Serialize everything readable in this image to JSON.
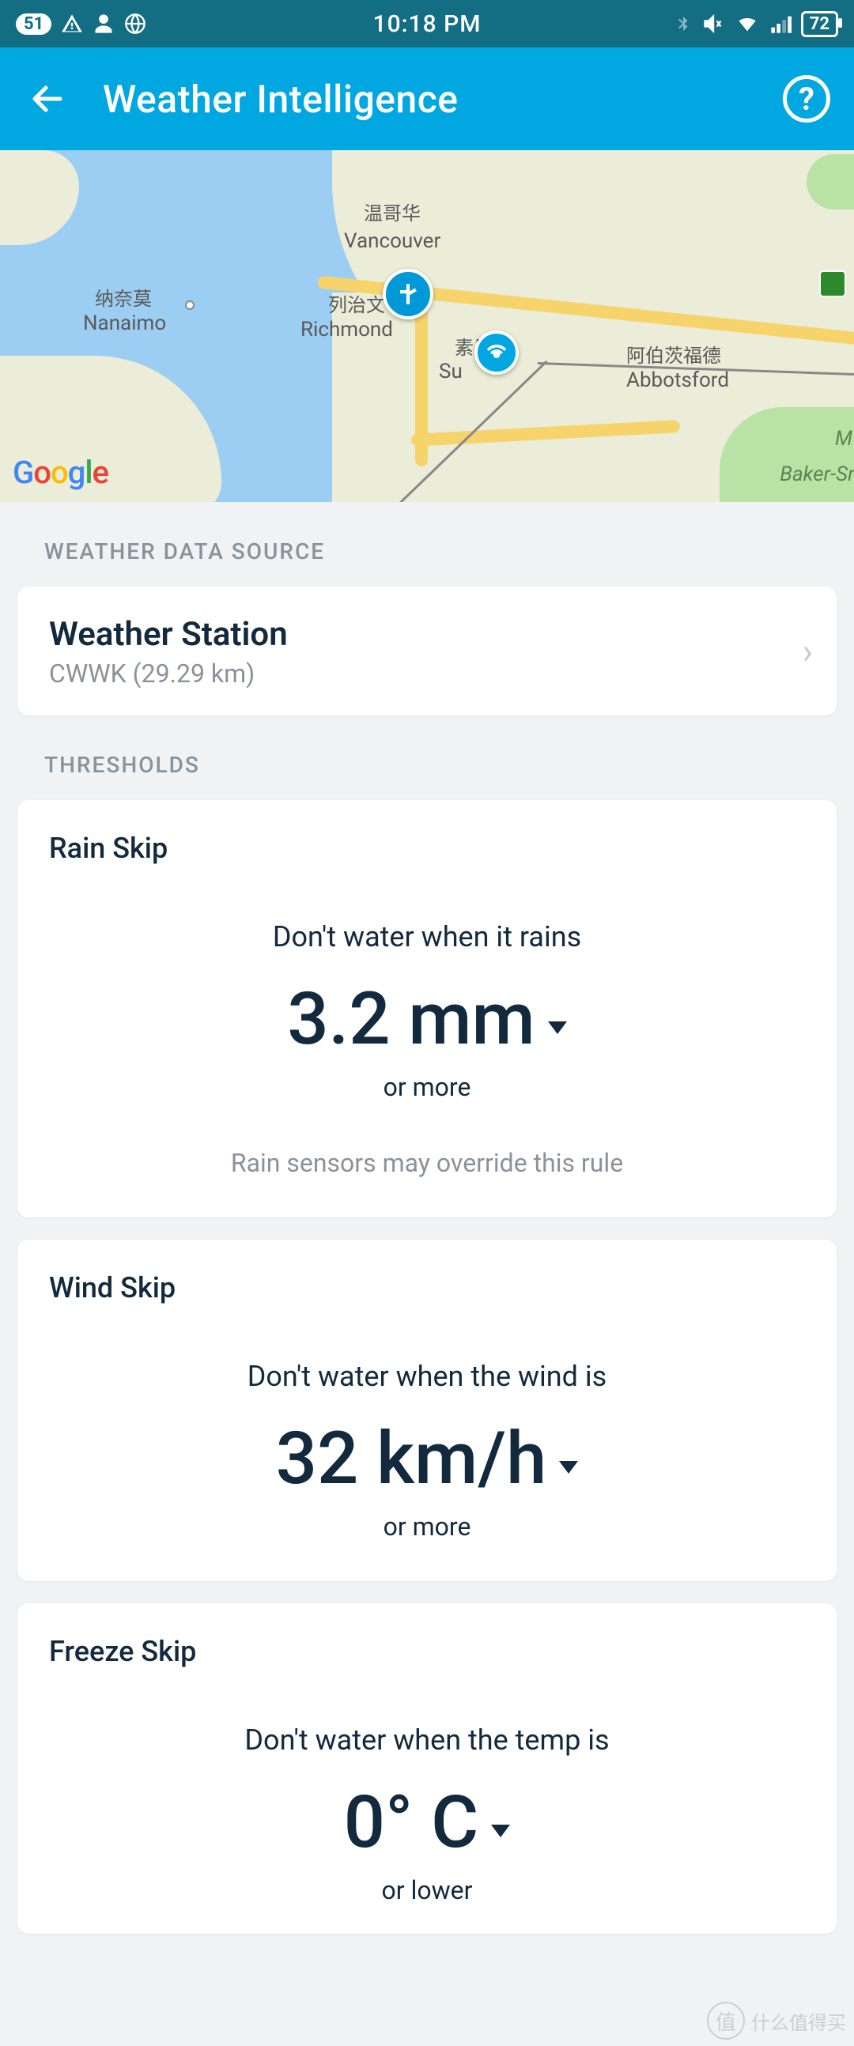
{
  "status": {
    "notif_count": "51",
    "time": "10:18 PM",
    "battery": "72"
  },
  "header": {
    "title": "Weather Intelligence",
    "help": "?"
  },
  "map": {
    "labels": {
      "vancouver_cn": "温哥华",
      "vancouver_en": "Vancouver",
      "richmond_cn": "列治文",
      "richmond_en": "Richmond",
      "surrey_cn": "素里",
      "surrey_en": "Su",
      "nanaimo_cn": "纳奈莫",
      "nanaimo_en": "Nanaimo",
      "abbotsford_cn": "阿伯茨福德",
      "abbotsford_en": "Abbotsford",
      "baker": "Baker-Sn",
      "letter_m": "M"
    },
    "logo": "Google"
  },
  "sections": {
    "source_label": "WEATHER DATA SOURCE",
    "thresholds_label": "THRESHOLDS"
  },
  "station": {
    "title": "Weather Station",
    "sub": "CWWK (29.29 km)"
  },
  "thresholds": {
    "rain": {
      "title": "Rain Skip",
      "line": "Don't water when it rains",
      "value": "3.2 mm",
      "sub": "or more",
      "note": "Rain sensors may override this rule"
    },
    "wind": {
      "title": "Wind Skip",
      "line": "Don't water when the wind is",
      "value": "32 km/h",
      "sub": "or more"
    },
    "freeze": {
      "title": "Freeze Skip",
      "line": "Don't water when the temp is",
      "value": "0° C",
      "sub": "or lower"
    }
  },
  "watermark": {
    "coin": "值",
    "text": "什么值得买"
  }
}
